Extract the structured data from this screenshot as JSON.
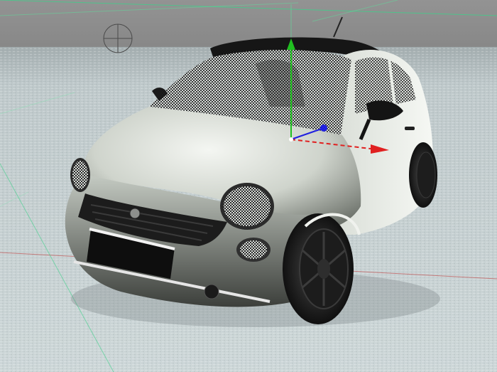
{
  "viewport": {
    "projection": "perspective",
    "display_mode": "gouraud shading",
    "background_color": "#8e8e8e",
    "floor_color": "#c9d3d4",
    "grid_axis_colors": {
      "x": "#b03030",
      "z": "#2fb86a"
    }
  },
  "scene": {
    "object": "car-model",
    "body_color": "#e9ede7",
    "window_style": "checker-transparency",
    "roof_color": "#151515",
    "selected": true
  },
  "gizmo": {
    "type": "move",
    "axes": [
      {
        "axis": "x",
        "color": "#e02020"
      },
      {
        "axis": "y",
        "color": "#20c020"
      },
      {
        "axis": "z",
        "color": "#2020e0"
      }
    ]
  },
  "camera_icon": "camera-target-icon"
}
